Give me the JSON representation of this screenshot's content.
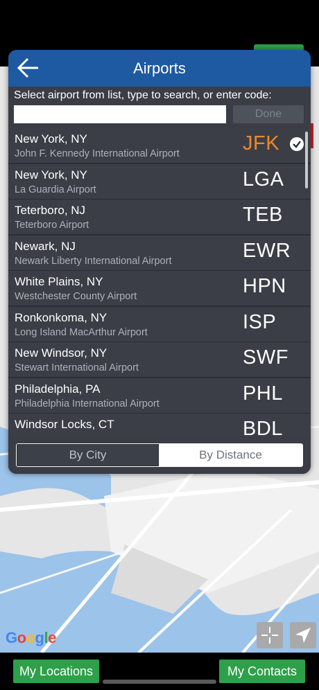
{
  "dialog": {
    "title": "Airports",
    "instruction": "Select airport from list, type to search, or enter code:",
    "search_value": "",
    "done_label": "Done"
  },
  "airports": [
    {
      "city": "New York, NY",
      "name": "John F. Kennedy International Airport",
      "code": "JFK",
      "selected": true
    },
    {
      "city": "New York, NY",
      "name": "La Guardia Airport",
      "code": "LGA"
    },
    {
      "city": "Teterboro, NJ",
      "name": "Teterboro Airport",
      "code": "TEB"
    },
    {
      "city": "Newark, NJ",
      "name": "Newark Liberty International Airport",
      "code": "EWR"
    },
    {
      "city": "White Plains, NY",
      "name": "Westchester County Airport",
      "code": "HPN"
    },
    {
      "city": "Ronkonkoma, NY",
      "name": "Long Island MacArthur Airport",
      "code": "ISP"
    },
    {
      "city": "New Windsor, NY",
      "name": "Stewart International Airport",
      "code": "SWF"
    },
    {
      "city": "Philadelphia, PA",
      "name": "Philadelphia International Airport",
      "code": "PHL"
    },
    {
      "city": "Windsor Locks, CT",
      "name": "",
      "code": "BDL"
    }
  ],
  "sort": {
    "by_city": "By City",
    "by_distance": "By Distance",
    "active": "by_city"
  },
  "map": {
    "logo": "Google"
  },
  "bottom": {
    "my_locations": "My Locations",
    "my_contacts": "My Contacts"
  },
  "colors": {
    "accent_blue": "#1e5aa1",
    "selected_code": "#f0882a",
    "button_green": "#2ea04a"
  },
  "icons": [
    "back-arrow-icon",
    "checkmark-icon",
    "crosshair-icon",
    "location-arrow-icon"
  ]
}
